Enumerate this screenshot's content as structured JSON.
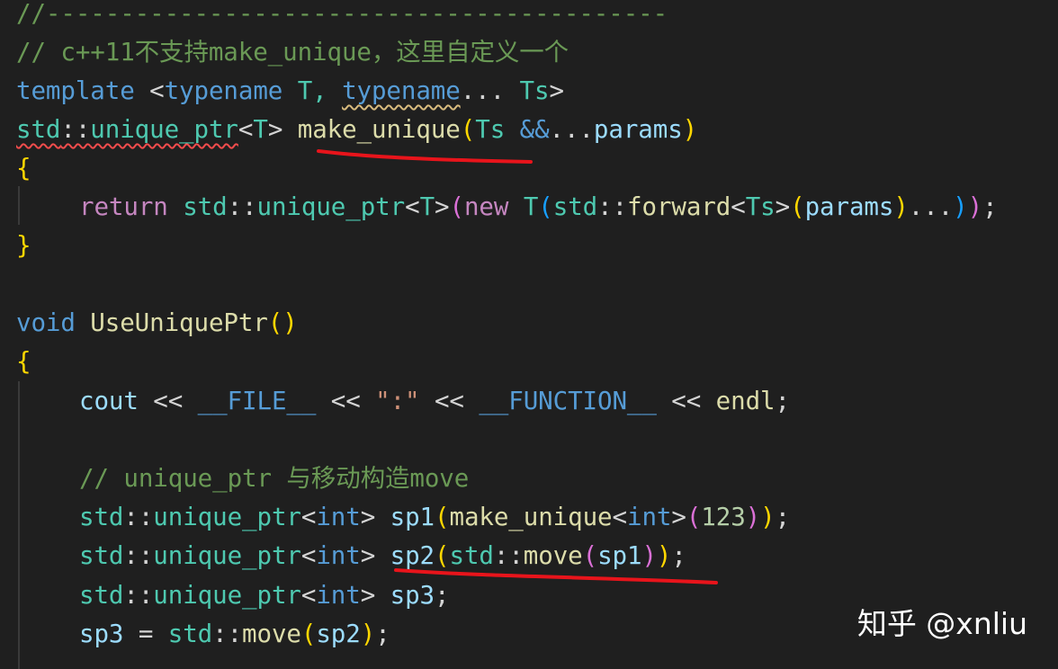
{
  "lines": {
    "l1": "//------------------------------------------",
    "l2": "// c++11不支持make_unique，这里自定义一个",
    "l3": {
      "a": "template",
      "b": " <",
      "c": "typename",
      "d": " T, ",
      "e": "typename",
      "f": "... ",
      "g": "Ts",
      "h": ">"
    },
    "l4": {
      "a": "std",
      "b": "::",
      "c": "unique_ptr",
      "d": "<",
      "e": "T",
      "f": "> ",
      "g": "make_unique",
      "h": "(",
      "i": "Ts",
      "j": " ",
      "k": "&&",
      "l": "...",
      "m": "params",
      "n": ")"
    },
    "l5": "{",
    "l6": {
      "a": "return",
      "b": " ",
      "c": "std",
      "d": "::",
      "e": "unique_ptr",
      "f": "<",
      "g": "T",
      "h": ">",
      "i": "(",
      "j": "new",
      "k": " ",
      "l": "T",
      "m": "(",
      "n": "std",
      "o": "::",
      "p": "forward",
      "q": "<",
      "r": "Ts",
      "s": ">",
      "t": "(",
      "u": "params",
      "v": ")",
      "w": "...",
      "x": ")",
      "y": ")",
      "z": ";"
    },
    "l7": "}",
    "l8": {
      "a": "void",
      "b": " ",
      "c": "UseUniquePtr",
      "d": "()"
    },
    "l9": "{",
    "l10": {
      "a": "cout",
      "b": " << ",
      "c": "__FILE__",
      "d": " << ",
      "e": "\":\"",
      "f": " << ",
      "g": "__FUNCTION__",
      "h": " << ",
      "i": "endl",
      "j": ";"
    },
    "l11": "// unique_ptr 与移动构造move",
    "l12": {
      "a": "std",
      "b": "::",
      "c": "unique_ptr",
      "d": "<",
      "e": "int",
      "f": "> ",
      "g": "sp1",
      "h": "(",
      "i": "make_unique",
      "j": "<",
      "k": "int",
      "l": ">",
      "m": "(",
      "n": "123",
      "o": ")",
      "p": ")",
      "q": ";"
    },
    "l13": {
      "a": "std",
      "b": "::",
      "c": "unique_ptr",
      "d": "<",
      "e": "int",
      "f": "> ",
      "g": "sp2",
      "h": "(",
      "i": "std",
      "j": "::",
      "k": "move",
      "l": "(",
      "m": "sp1",
      "n": ")",
      "o": ")",
      "p": ";"
    },
    "l14": {
      "a": "std",
      "b": "::",
      "c": "unique_ptr",
      "d": "<",
      "e": "int",
      "f": "> ",
      "g": "sp3",
      "h": ";"
    },
    "l15": {
      "a": "sp3",
      "b": " = ",
      "c": "std",
      "d": "::",
      "e": "move",
      "f": "(",
      "g": "sp2",
      "h": ")",
      "i": ";"
    }
  },
  "watermark": "知乎 @xnliu",
  "colors": {
    "background": "#1f1f1f",
    "comment": "#6a9955",
    "keyword": "#569cd6",
    "type": "#4ec9b0",
    "function": "#dcdcaa",
    "variable": "#9cdcfe",
    "annotation_underline": "#e8141b"
  }
}
